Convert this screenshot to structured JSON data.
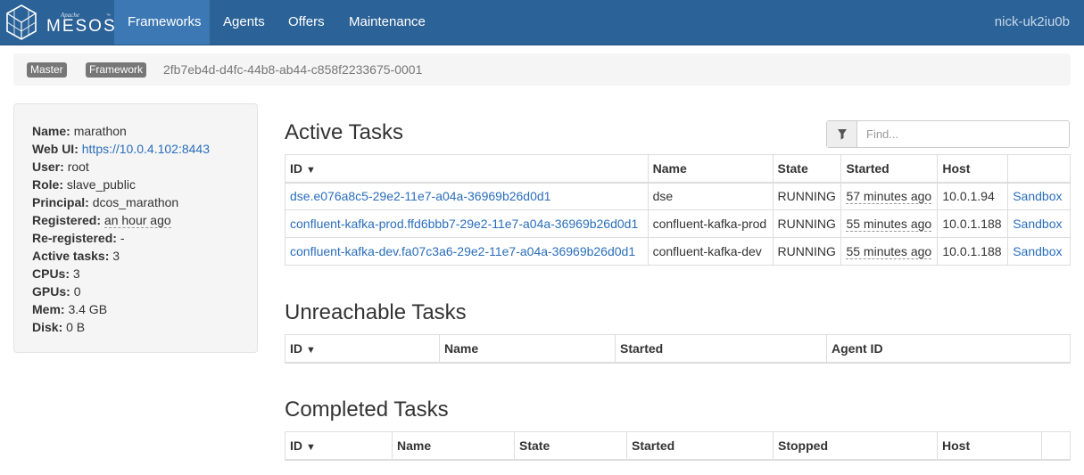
{
  "navbar": {
    "logo_apache": "Apache",
    "logo_text": "MESOS",
    "logo_tm": "™",
    "items": [
      "Frameworks",
      "Agents",
      "Offers",
      "Maintenance"
    ],
    "active": "Frameworks",
    "user": "nick-uk2iu0b",
    "color": "#2b6297"
  },
  "breadcrumb": {
    "master": "Master",
    "sep": "/",
    "framework": "Framework",
    "framework_id": "2fb7eb4d-d4fc-44b8-ab44-c858f2233675-0001"
  },
  "info": {
    "name_label": "Name:",
    "name": "marathon",
    "webui_label": "Web UI:",
    "webui": "https://10.0.4.102:8443",
    "user_label": "User:",
    "user": "root",
    "role_label": "Role:",
    "role": "slave_public",
    "principal_label": "Principal:",
    "principal": "dcos_marathon",
    "registered_label": "Registered:",
    "registered": "an hour ago",
    "reregistered_label": "Re-registered:",
    "reregistered": "-",
    "active_tasks_label": "Active tasks:",
    "active_tasks": "3",
    "cpus_label": "CPUs:",
    "cpus": "3",
    "gpus_label": "GPUs:",
    "gpus": "0",
    "mem_label": "Mem:",
    "mem": "3.4 GB",
    "disk_label": "Disk:",
    "disk": "0 B"
  },
  "active": {
    "title": "Active Tasks",
    "search_placeholder": "Find...",
    "headers": {
      "id": "ID",
      "name": "Name",
      "state": "State",
      "started": "Started",
      "host": "Host"
    },
    "sort_arrow": "▼",
    "rows": [
      {
        "id": "dse.e076a8c5-29e2-11e7-a04a-36969b26d0d1",
        "name": "dse",
        "state": "RUNNING",
        "started": "57 minutes ago",
        "host": "10.0.1.94",
        "sandbox": "Sandbox"
      },
      {
        "id": "confluent-kafka-prod.ffd6bbb7-29e2-11e7-a04a-36969b26d0d1",
        "name": "confluent-kafka-prod",
        "state": "RUNNING",
        "started": "55 minutes ago",
        "host": "10.0.1.188",
        "sandbox": "Sandbox"
      },
      {
        "id": "confluent-kafka-dev.fa07c3a6-29e2-11e7-a04a-36969b26d0d1",
        "name": "confluent-kafka-dev",
        "state": "RUNNING",
        "started": "55 minutes ago",
        "host": "10.0.1.188",
        "sandbox": "Sandbox"
      }
    ]
  },
  "unreachable": {
    "title": "Unreachable Tasks",
    "headers": {
      "id": "ID",
      "name": "Name",
      "started": "Started",
      "agent": "Agent ID"
    }
  },
  "completed": {
    "title": "Completed Tasks",
    "headers": {
      "id": "ID",
      "name": "Name",
      "state": "State",
      "started": "Started",
      "stopped": "Stopped",
      "host": "Host"
    }
  }
}
